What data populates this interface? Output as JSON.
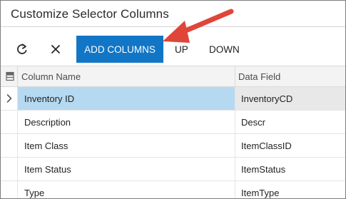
{
  "dialog": {
    "title": "Customize Selector Columns"
  },
  "toolbar": {
    "refresh_icon": "refresh-icon",
    "close_icon": "close-icon",
    "add_columns_label": "ADD COLUMNS",
    "up_label": "UP",
    "down_label": "DOWN",
    "accent_color": "#1176c6"
  },
  "grid": {
    "header_icon": "column-config-icon",
    "columns": [
      "Column Name",
      "Data Field"
    ],
    "rows": [
      {
        "name": "Inventory ID",
        "field": "InventoryCD",
        "selected": true
      },
      {
        "name": "Description",
        "field": "Descr",
        "selected": false
      },
      {
        "name": "Item Class",
        "field": "ItemClassID",
        "selected": false
      },
      {
        "name": "Item Status",
        "field": "ItemStatus",
        "selected": false
      },
      {
        "name": "Type",
        "field": "ItemType",
        "selected": false
      }
    ],
    "selected_color": "#b6d9f2"
  },
  "annotation": {
    "arrow_color": "#e0453a",
    "target": "ADD COLUMNS button"
  }
}
